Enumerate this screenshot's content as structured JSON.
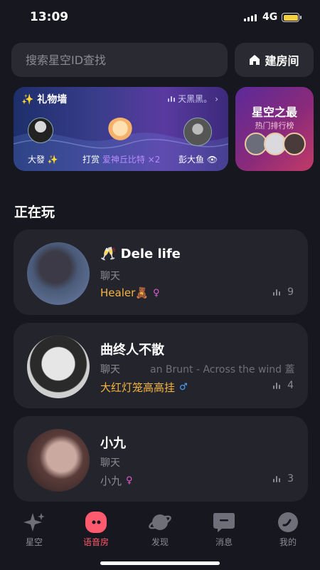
{
  "status": {
    "time": "13:09",
    "network": "4G"
  },
  "search": {
    "placeholder": "搜索星空ID查找"
  },
  "create_room": {
    "label": "建房间"
  },
  "gift_wall": {
    "title": "✨ 礼物墙",
    "marquee": "天黑黑。",
    "sender": "大發 ✨",
    "action": "打赏",
    "gift": "爱神丘比特 ×2",
    "receiver": "彭大鱼"
  },
  "ranking": {
    "title": "星空之最",
    "subtitle": "热门排行榜"
  },
  "section": {
    "title": "正在玩"
  },
  "rooms": [
    {
      "name": "🥂 Dele life",
      "type": "聊天",
      "song": "",
      "tag": "Healer🧸",
      "tag_color": "#f5b53f",
      "gender": "♀",
      "gender_color": "#e05bd0",
      "count": "9"
    },
    {
      "name": "曲终人不散",
      "type": "聊天",
      "song": "an Brunt - Across the wind  蓋",
      "tag": "大红灯笼高高挂",
      "tag_color": "#f5b53f",
      "gender": "♂",
      "gender_color": "#4aa8ff",
      "count": "4"
    },
    {
      "name": "小九",
      "type": "聊天",
      "song": "",
      "tag": "小九",
      "tag_color": "#8b8b95",
      "gender": "♀",
      "gender_color": "#e05bd0",
      "count": "3"
    }
  ],
  "tabs": [
    {
      "label": "星空",
      "icon": "sparkle-icon"
    },
    {
      "label": "语音房",
      "icon": "voice-room-icon"
    },
    {
      "label": "发现",
      "icon": "planet-icon"
    },
    {
      "label": "消息",
      "icon": "message-icon"
    },
    {
      "label": "我的",
      "icon": "profile-icon"
    }
  ],
  "colors": {
    "active_tab": "#ff5a6e",
    "background": "#17171f",
    "card": "#24242d"
  }
}
